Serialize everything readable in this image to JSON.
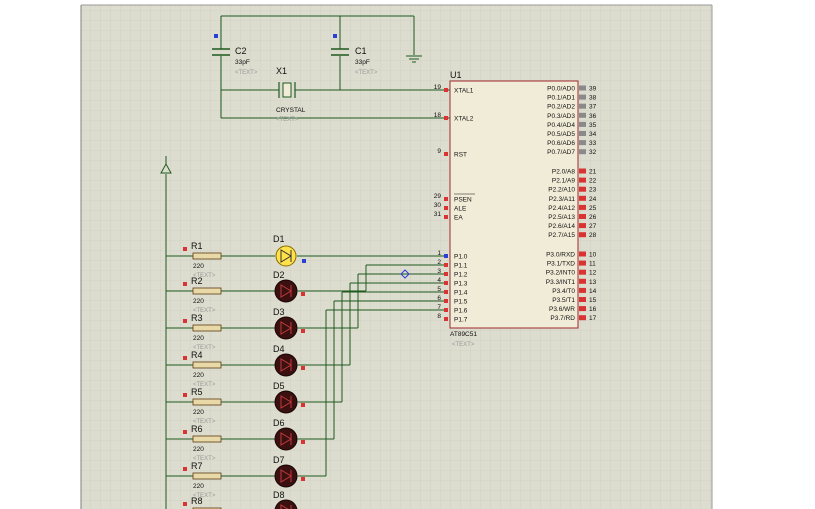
{
  "capacitors": [
    {
      "ref": "C2",
      "value": "33pF",
      "text": "<TEXT>"
    },
    {
      "ref": "C1",
      "value": "33pF",
      "text": "<TEXT>"
    }
  ],
  "crystal": {
    "ref": "X1",
    "value": "CRYSTAL",
    "text": "<TEXT>"
  },
  "mcu": {
    "ref": "U1",
    "part": "AT89C51",
    "text": "<TEXT>",
    "left_pins": [
      {
        "num": "19",
        "name": "XTAL1"
      },
      {
        "num": "18",
        "name": "XTAL2"
      },
      {
        "num": "9",
        "name": "RST"
      },
      {
        "num": "29",
        "name": "PSEN"
      },
      {
        "num": "30",
        "name": "ALE"
      },
      {
        "num": "31",
        "name": "EA"
      },
      {
        "num": "1",
        "name": "P1.0"
      },
      {
        "num": "2",
        "name": "P1.1"
      },
      {
        "num": "3",
        "name": "P1.2"
      },
      {
        "num": "4",
        "name": "P1.3"
      },
      {
        "num": "5",
        "name": "P1.4"
      },
      {
        "num": "6",
        "name": "P1.5"
      },
      {
        "num": "7",
        "name": "P1.6"
      },
      {
        "num": "8",
        "name": "P1.7"
      }
    ],
    "right_pins": [
      {
        "num": "39",
        "name": "P0.0/AD0"
      },
      {
        "num": "38",
        "name": "P0.1/AD1"
      },
      {
        "num": "37",
        "name": "P0.2/AD2"
      },
      {
        "num": "36",
        "name": "P0.3/AD3"
      },
      {
        "num": "35",
        "name": "P0.4/AD4"
      },
      {
        "num": "34",
        "name": "P0.5/AD5"
      },
      {
        "num": "33",
        "name": "P0.6/AD6"
      },
      {
        "num": "32",
        "name": "P0.7/AD7"
      },
      {
        "num": "21",
        "name": "P2.0/A8"
      },
      {
        "num": "22",
        "name": "P2.1/A9"
      },
      {
        "num": "23",
        "name": "P2.2/A10"
      },
      {
        "num": "24",
        "name": "P2.3/A11"
      },
      {
        "num": "25",
        "name": "P2.4/A12"
      },
      {
        "num": "26",
        "name": "P2.5/A13"
      },
      {
        "num": "27",
        "name": "P2.6/A14"
      },
      {
        "num": "28",
        "name": "P2.7/A15"
      },
      {
        "num": "10",
        "name": "P3.0/RXD"
      },
      {
        "num": "11",
        "name": "P3.1/TXD"
      },
      {
        "num": "12",
        "name": "P3.2/INT0"
      },
      {
        "num": "13",
        "name": "P3.3/INT1"
      },
      {
        "num": "14",
        "name": "P3.4/T0"
      },
      {
        "num": "15",
        "name": "P3.5/T1"
      },
      {
        "num": "16",
        "name": "P3.6/WR"
      },
      {
        "num": "17",
        "name": "P3.7/RD"
      }
    ]
  },
  "resistors": [
    {
      "ref": "R1",
      "value": "220",
      "text": "<TEXT>"
    },
    {
      "ref": "R2",
      "value": "220",
      "text": "<TEXT>"
    },
    {
      "ref": "R3",
      "value": "220",
      "text": "<TEXT>"
    },
    {
      "ref": "R4",
      "value": "220",
      "text": "<TEXT>"
    },
    {
      "ref": "R5",
      "value": "220",
      "text": "<TEXT>"
    },
    {
      "ref": "R6",
      "value": "220",
      "text": "<TEXT>"
    },
    {
      "ref": "R7",
      "value": "220",
      "text": "<TEXT>"
    },
    {
      "ref": "R8",
      "value": "",
      "text": ""
    }
  ],
  "leds": [
    {
      "ref": "D1",
      "lit": true
    },
    {
      "ref": "D2",
      "lit": false
    },
    {
      "ref": "D3",
      "lit": false
    },
    {
      "ref": "D4",
      "lit": false
    },
    {
      "ref": "D5",
      "lit": false
    },
    {
      "ref": "D6",
      "lit": false
    },
    {
      "ref": "D7",
      "lit": false
    },
    {
      "ref": "D8",
      "lit": false
    }
  ],
  "colors": {
    "grid_bg": "#dcdccf",
    "grid_line": "#c9c9bb",
    "wire": "#1f5a1f",
    "body_fill": "#f1ecd8",
    "body_stroke": "#a0282a",
    "pin_red": "#d83434",
    "pin_gray": "#8a8a8a",
    "pin_blue": "#2b3fd6",
    "led_lit": "#ffe14a",
    "led_off": "#3a1010"
  }
}
